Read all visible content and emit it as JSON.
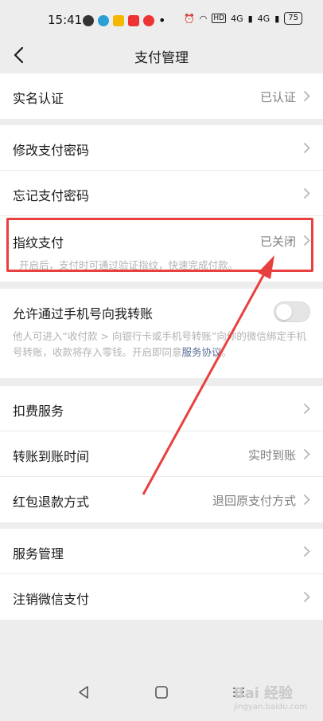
{
  "status_bar": {
    "time": "15:41",
    "signal_1": "4G",
    "signal_2": "4G",
    "battery": "75"
  },
  "nav": {
    "title": "支付管理"
  },
  "groups": {
    "g1": [
      {
        "label": "实名认证",
        "value": "已认证"
      }
    ],
    "g2": [
      {
        "label": "修改支付密码",
        "value": ""
      },
      {
        "label": "忘记支付密码",
        "value": ""
      },
      {
        "label": "指纹支付",
        "value": "已关闭",
        "desc": "开启后，支付时可通过验证指纹，快速完成付款。"
      }
    ],
    "g3": {
      "label": "允许通过手机号向我转账",
      "desc_pre": "他人可进入“收付款 > 向银行卡或手机号转账”向你的微信绑定手机号转账，收款将存入零钱。开启即同意",
      "link": "服务协议",
      "desc_post": "。",
      "toggle_on": false
    },
    "g4": [
      {
        "label": "扣费服务",
        "value": ""
      },
      {
        "label": "转账到账时间",
        "value": "实时到账"
      },
      {
        "label": "红包退款方式",
        "value": "退回原支付方式"
      }
    ],
    "g5": [
      {
        "label": "服务管理",
        "value": ""
      },
      {
        "label": "注销微信支付",
        "value": ""
      }
    ]
  },
  "watermark": {
    "text": "Bai 经验",
    "sub": "jingyan.baidu.com"
  },
  "colors": {
    "highlight": "#e8403f",
    "link": "#576b95"
  }
}
